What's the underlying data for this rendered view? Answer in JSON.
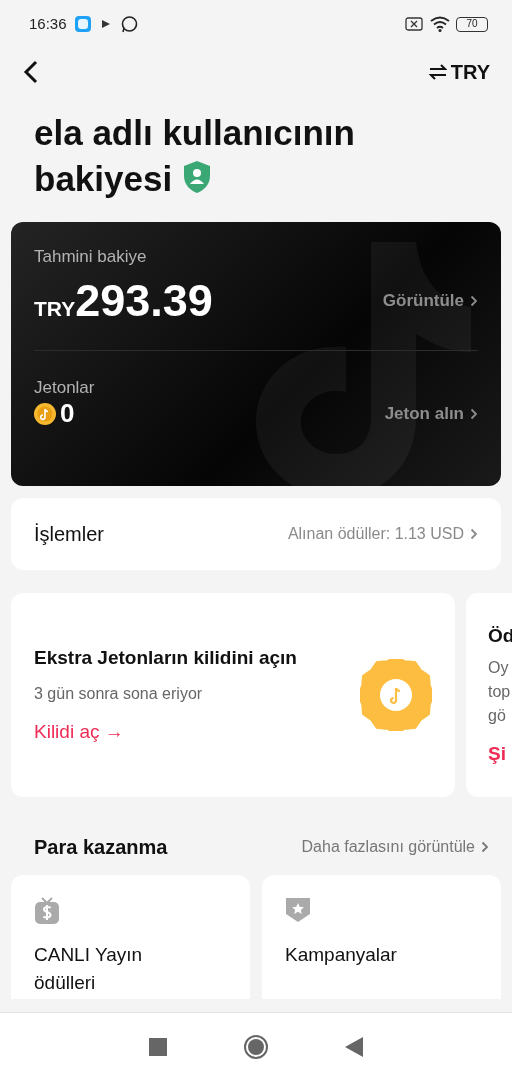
{
  "status_bar": {
    "time": "16:36",
    "battery": "70"
  },
  "header": {
    "currency": "TRY"
  },
  "title": "ela adlı kullanıcının bakiyesi",
  "balance_card": {
    "label": "Tahmini bakiye",
    "currency": "TRY",
    "amount": "293.39",
    "view_link": "Görüntüle",
    "coins_label": "Jetonlar",
    "coins": "0",
    "buy_link": "Jeton alın"
  },
  "transactions": {
    "label": "İşlemler",
    "rewards": "Alınan ödüller: 1.13 USD"
  },
  "promos": [
    {
      "kind": "full",
      "title": "Ekstra Jetonların kilidini açın",
      "subtitle": "3 gün sonra sona eriyor",
      "action": "Kilidi aç →"
    },
    {
      "kind": "partial",
      "title": "Öd",
      "lines": [
        "Oy",
        "top",
        "gö"
      ],
      "action": "Şi"
    }
  ],
  "monetization": {
    "title": "Para kazanma",
    "more": "Daha fazlasını görüntüle",
    "cards": [
      {
        "kind": "live",
        "label": "CANLI Yayın ödülleri"
      },
      {
        "kind": "campaign",
        "label": "Kampanyalar"
      }
    ]
  }
}
